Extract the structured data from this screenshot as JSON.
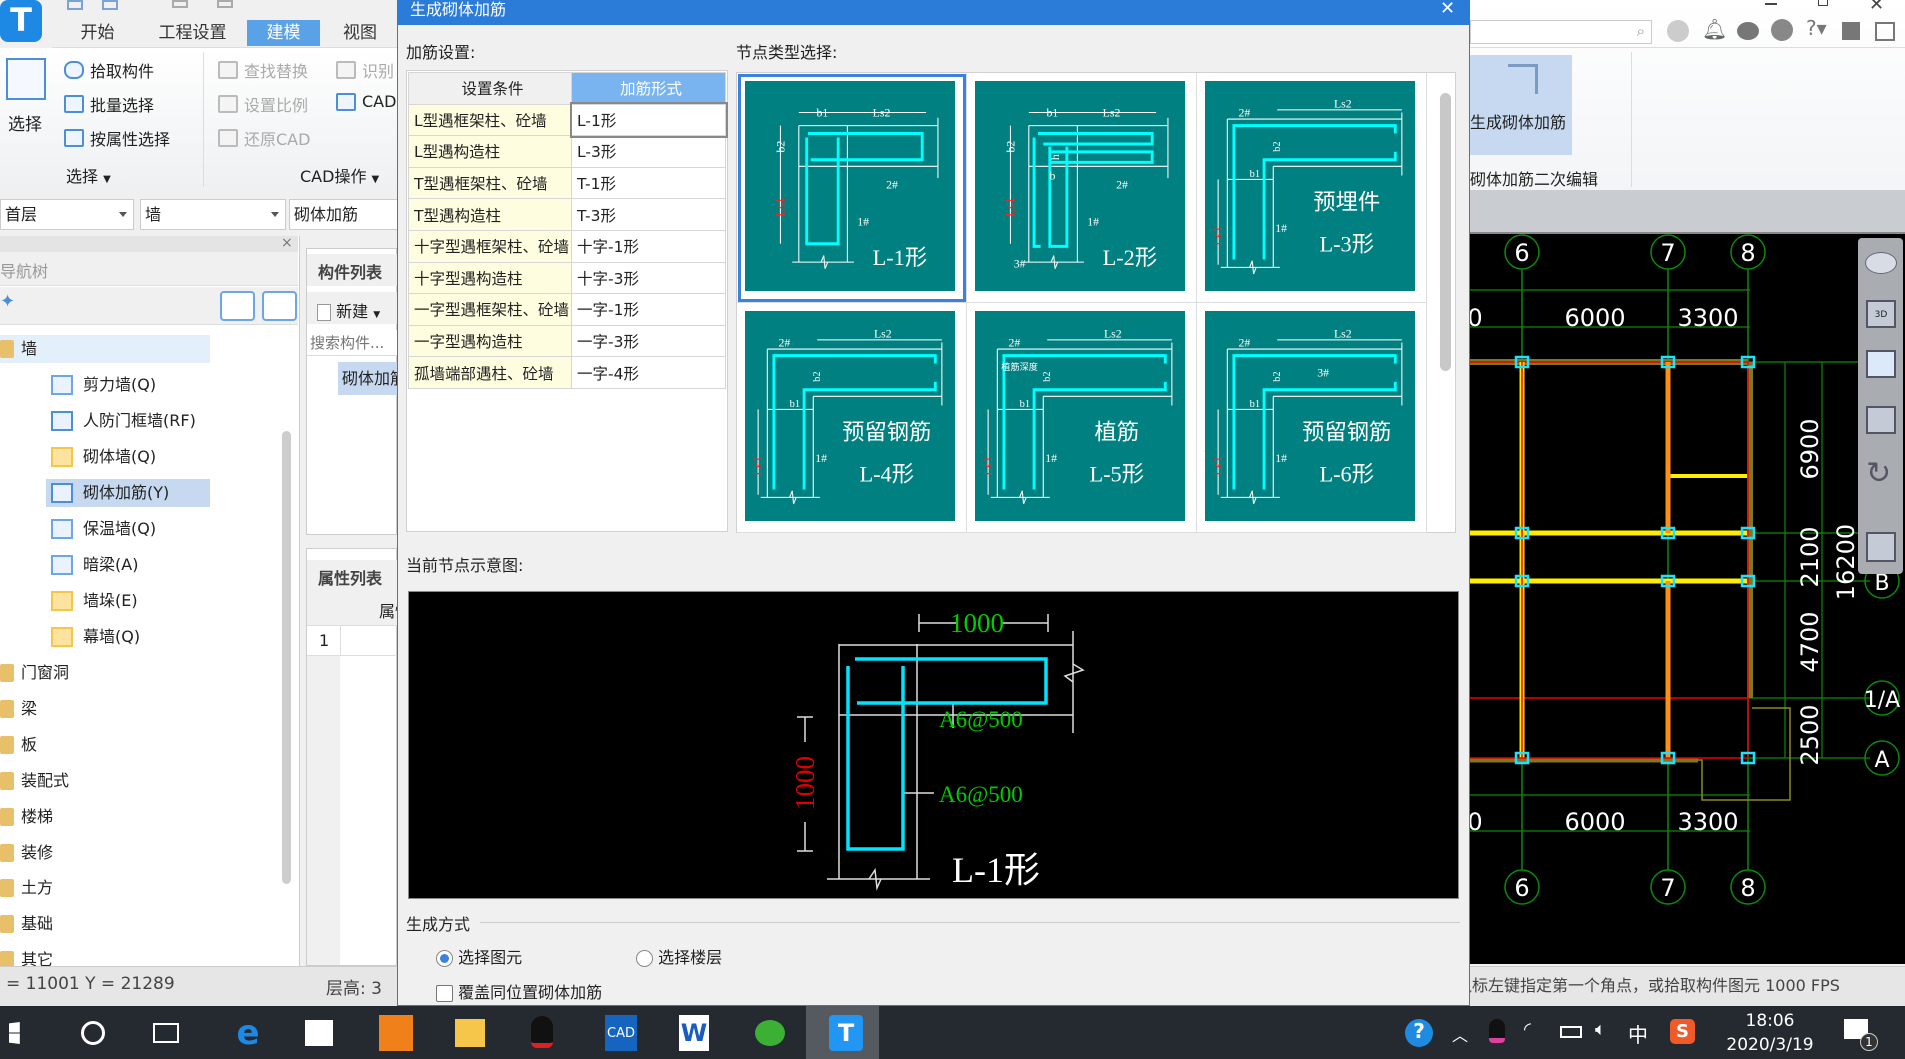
{
  "app": {
    "logo_letter": "T",
    "tabs": [
      "开始",
      "工程设置",
      "建模",
      "视图"
    ],
    "active_tab": "建模",
    "ribbon": {
      "select_big": "选择",
      "select_items": [
        "拾取构件",
        "批量选择",
        "按属性选择"
      ],
      "select_group": "选择",
      "cad_items": [
        "查找替换",
        "设置比例",
        "还原CAD"
      ],
      "cad_items2": [
        "识别",
        "CAD"
      ],
      "cad_group": "CAD操作",
      "generate_button": "生成砌体加筋",
      "secondary_edit": "砌体加筋二次编辑"
    },
    "dropdowns": {
      "floor": "首层",
      "category": "墙",
      "type": "砌体加筋"
    },
    "nav": {
      "title": "导航树",
      "root": "墙",
      "children": [
        "剪力墙(Q)",
        "人防门框墙(RF)",
        "砌体墙(Q)",
        "砌体加筋(Y)",
        "保温墙(Q)",
        "暗梁(A)",
        "墙垛(E)",
        "幕墙(Q)"
      ],
      "selected_child": "砌体加筋(Y)",
      "folders": [
        "门窗洞",
        "梁",
        "板",
        "装配式",
        "楼梯",
        "装修",
        "土方",
        "基础",
        "其它"
      ]
    },
    "component_list": {
      "title": "构件列表",
      "new_label": "新建",
      "search_placeholder": "搜索构件...",
      "items": [
        "砌体加筋"
      ]
    },
    "property_list": {
      "title": "属性列表",
      "col_header": "属性名称",
      "rows": [
        "1"
      ]
    },
    "status": {
      "coords": "= 11001 Y = 21289",
      "floor_height": "层高:  3",
      "prompt": "鼠标左键指定第一个角点，或拾取构件图元",
      "fps": "1000 FPS"
    },
    "cad": {
      "axes_x": [
        "6",
        "7",
        "8"
      ],
      "axes_y": [
        "B",
        "1/A",
        "A"
      ],
      "dims_top": [
        "0",
        "6000",
        "3300"
      ],
      "dims_bottom": [
        "0",
        "6000",
        "3300"
      ],
      "dims_right": [
        "6900",
        "2100",
        "4700",
        "2500"
      ],
      "dim_total": "16200"
    }
  },
  "dialog": {
    "title": "生成砌体加筋",
    "settings_label": "加筋设置:",
    "table": {
      "headers": [
        "设置条件",
        "加筋形式"
      ],
      "rows": [
        [
          "L型遇框架柱、砼墙",
          "L-1形"
        ],
        [
          "L型遇构造柱",
          "L-3形"
        ],
        [
          "T型遇框架柱、砼墙",
          "T-1形"
        ],
        [
          "T型遇构造柱",
          "T-3形"
        ],
        [
          "十字型遇框架柱、砼墙",
          "十字-1形"
        ],
        [
          "十字型遇构造柱",
          "十字-3形"
        ],
        [
          "一字型遇框架柱、砼墙",
          "一字-1形"
        ],
        [
          "一字型遇构造柱",
          "一字-3形"
        ],
        [
          "孤墙端部遇柱、砼墙",
          "一字-4形"
        ]
      ],
      "selected_row": 0
    },
    "node_type_label": "节点类型选择:",
    "tiles": [
      {
        "name": "L-1形",
        "caption": "",
        "b1": "b1",
        "Ls2": "Ls2",
        "b2": "b2",
        "Ls1": "Ls1",
        "n1": "1#",
        "n2": "2#"
      },
      {
        "name": "L-2形",
        "caption": "",
        "b1": "b1",
        "Ls2": "Ls2",
        "b2": "b2",
        "Ls1": "Ls1",
        "n1": "1#",
        "n2": "2#",
        "n3": "3#",
        "h": "h",
        "b": "b"
      },
      {
        "name": "L-3形",
        "caption": "预埋件",
        "b1": "b1",
        "Ls2": "Ls2",
        "b2": "b2",
        "Ls1": "Ls1",
        "n1": "1#",
        "n2": "2#"
      },
      {
        "name": "L-4形",
        "caption": "预留钢筋",
        "b1": "b1",
        "Ls2": "Ls2",
        "b2": "b2",
        "Ls1": "Ls1",
        "n1": "1#",
        "n2": "2#"
      },
      {
        "name": "L-5形",
        "caption": "植筋",
        "b1": "b1",
        "Ls2": "Ls2",
        "b2": "b2",
        "Ls1": "Ls1",
        "n1": "1#",
        "n2": "2#",
        "depth": "植筋深度"
      },
      {
        "name": "L-6形",
        "caption": "预留钢筋",
        "b1": "b1",
        "Ls2": "Ls2",
        "b2": "b2",
        "Ls1": "Ls1",
        "n1": "1#",
        "n2": "2#",
        "n3": "3#"
      }
    ],
    "selected_tile": 0,
    "preview_label": "当前节点示意图:",
    "preview": {
      "dim_h": "1000",
      "dim_v": "1000",
      "rebar1": "A6@500",
      "rebar2": "A6@500",
      "name": "L-1形"
    },
    "generate_label": "生成方式",
    "radio_options": [
      "选择图元",
      "选择楼层"
    ],
    "radio_selected": 0,
    "overwrite_label": "覆盖同位置砌体加筋",
    "overwrite_checked": false
  },
  "taskbar": {
    "apps": [
      "start-icon",
      "search-icon",
      "task-view-icon",
      "edge-icon",
      "store-icon",
      "pdf-icon",
      "file-explorer-icon",
      "qq-icon",
      "cad-icon",
      "word-icon",
      "wechat-icon",
      "gtj-app-icon"
    ],
    "cad_label": "CAD",
    "word_label": "W",
    "active_app": "gtj-app-icon",
    "ime": "中",
    "time": "18:06",
    "date": "2020/3/19",
    "notifications": "1"
  },
  "colors": {
    "accent": "#2b7bd8",
    "tile_bg": "#008080",
    "rebar": "#00ffff",
    "dim_red": "#ff0000",
    "dim_green": "#00cc00",
    "highlight": "#c6d9f0"
  }
}
